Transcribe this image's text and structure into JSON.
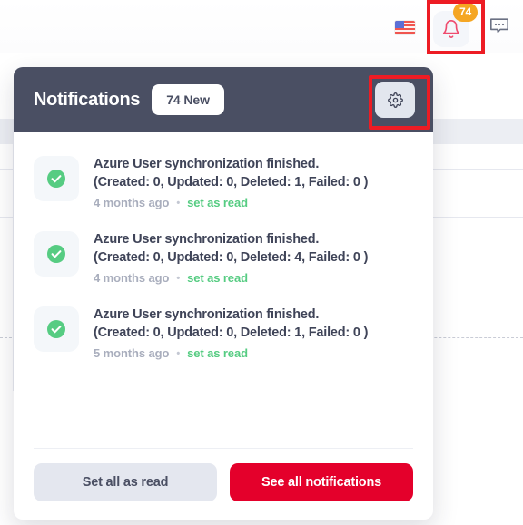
{
  "topbar": {
    "flag_icon": "us-flag-icon",
    "bell_icon": "bell-icon",
    "bell_badge": "74",
    "chat_icon": "chat-bubble-icon"
  },
  "notifications_panel": {
    "title": "Notifications",
    "new_count_label": "74 New",
    "settings_icon": "gear-icon",
    "items": [
      {
        "status_icon": "check-circle-icon",
        "line1": "Azure User synchronization finished.",
        "line2": "(Created: 0, Updated: 0, Deleted: 1, Failed: 0 )",
        "time": "4 months ago",
        "separator": "•",
        "action": "set as read"
      },
      {
        "status_icon": "check-circle-icon",
        "line1": "Azure User synchronization finished.",
        "line2": "(Created: 0, Updated: 0, Deleted: 4, Failed: 0 )",
        "time": "4 months ago",
        "separator": "•",
        "action": "set as read"
      },
      {
        "status_icon": "check-circle-icon",
        "line1": "Azure User synchronization finished.",
        "line2": "(Created: 0, Updated: 0, Deleted: 1, Failed: 0 )",
        "time": "5 months ago",
        "separator": "•",
        "action": "set as read"
      }
    ],
    "footer": {
      "set_all_label": "Set all as read",
      "see_all_label": "See all notifications"
    }
  },
  "colors": {
    "header_bg": "#4a4f63",
    "primary_red": "#e4002b",
    "badge_orange": "#f5a623",
    "success_green": "#56cc82",
    "annotation_red": "#ed1c24"
  }
}
